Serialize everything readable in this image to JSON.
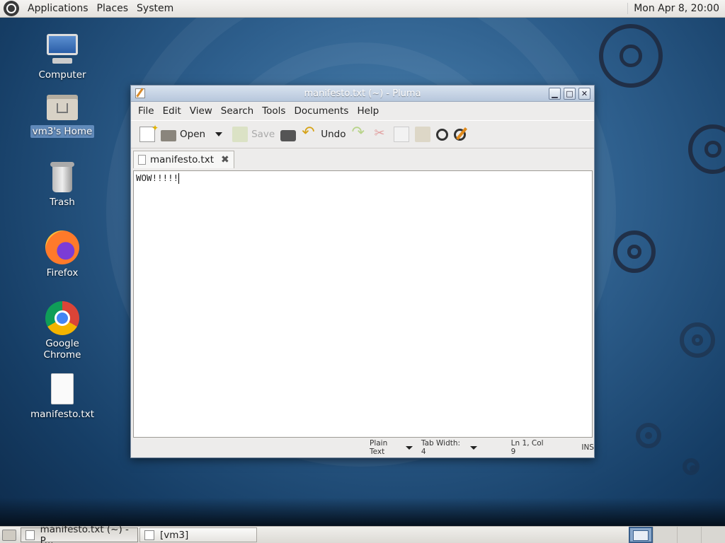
{
  "top_panel": {
    "menus": [
      "Applications",
      "Places",
      "System"
    ],
    "clock": "Mon Apr  8, 20:00"
  },
  "desktop": {
    "icons": [
      {
        "label": "Computer",
        "icon": "computer-icon"
      },
      {
        "label": "vm3's Home",
        "icon": "home-folder-icon"
      },
      {
        "label": "Trash",
        "icon": "trash-icon"
      },
      {
        "label": "Firefox",
        "icon": "firefox-icon"
      },
      {
        "label": "Google Chrome",
        "icon": "chrome-icon"
      },
      {
        "label": "manifesto.txt",
        "icon": "text-file-icon"
      }
    ]
  },
  "window": {
    "title": "manifesto.txt (~) - Pluma",
    "menu": [
      "File",
      "Edit",
      "View",
      "Search",
      "Tools",
      "Documents",
      "Help"
    ],
    "toolbar": {
      "open": "Open",
      "save": "Save",
      "undo": "Undo"
    },
    "tab": {
      "label": "manifesto.txt"
    },
    "editor": {
      "text": "WOW!!!!!"
    },
    "status": {
      "language": "Plain Text",
      "tab_width": "Tab Width:  4",
      "position": "Ln 1, Col 9",
      "mode": "INS"
    }
  },
  "taskbar": {
    "tasks": [
      {
        "label": "manifesto.txt (~) - P...",
        "active": true
      },
      {
        "label": "[vm3]",
        "active": false
      }
    ]
  }
}
